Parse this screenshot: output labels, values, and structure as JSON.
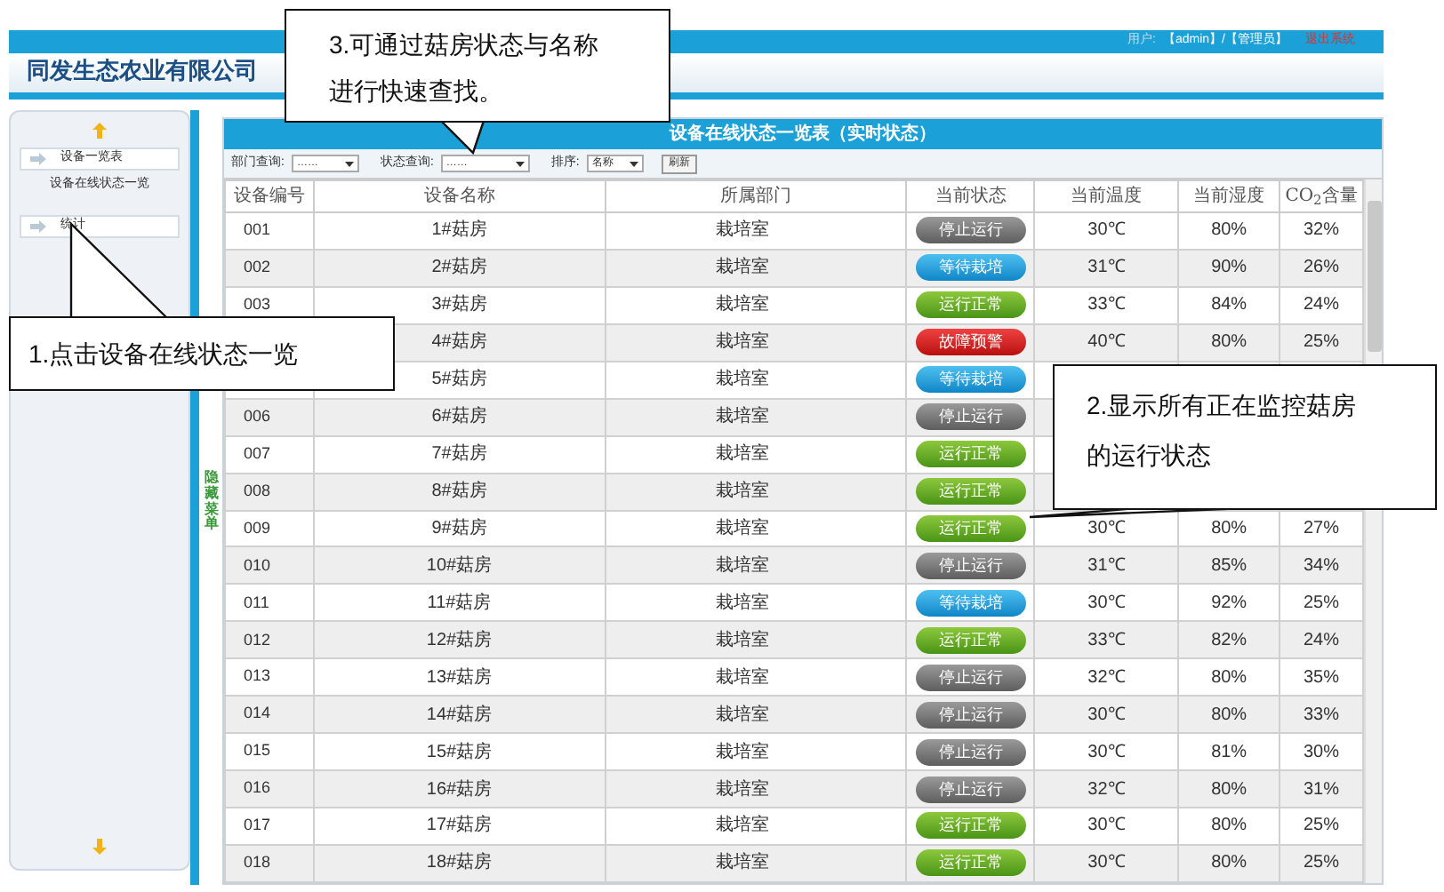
{
  "header": {
    "company": "同发生态农业有限公司",
    "user_label": "用户:",
    "user": "【admin】/【管理员】",
    "logout": "退出系统"
  },
  "sidebar": {
    "items": [
      {
        "label": "设备一览表",
        "kind": "button",
        "selected": false
      },
      {
        "label": "设备在线状态一览",
        "kind": "link",
        "selected": true
      },
      {
        "label": "统计",
        "kind": "button",
        "selected": false
      }
    ],
    "hide_menu": "隐藏菜单"
  },
  "panel": {
    "title": "设备在线状态一览表（实时状态）",
    "filters": [
      {
        "label": "部门查询:",
        "value": "……"
      },
      {
        "label": "状态查询:",
        "value": "……"
      },
      {
        "label": "排序:",
        "value": "名称"
      }
    ],
    "refresh": "刷新"
  },
  "table": {
    "columns": [
      "设备编号",
      "设备名称",
      "所属部门",
      "当前状态",
      "当前温度",
      "当前湿度",
      "CO$_{2}$含量"
    ],
    "rows": [
      {
        "code": "001",
        "name": "1#菇房",
        "dept": "栽培室",
        "status": "停止运行",
        "kind": "stopped",
        "temp": "30℃",
        "humidity": "80%",
        "co2": "32%"
      },
      {
        "code": "002",
        "name": "2#菇房",
        "dept": "栽培室",
        "status": "等待栽培",
        "kind": "waiting",
        "temp": "31℃",
        "humidity": "90%",
        "co2": "26%"
      },
      {
        "code": "003",
        "name": "3#菇房",
        "dept": "栽培室",
        "status": "运行正常",
        "kind": "running",
        "temp": "33℃",
        "humidity": "84%",
        "co2": "24%"
      },
      {
        "name": "4#菇房",
        "dept": "栽培室",
        "status": "故障预警",
        "kind": "fault",
        "temp": "40℃",
        "humidity": "80%",
        "co2": "25%"
      },
      {
        "name": "5#菇房",
        "dept": "栽培室",
        "status": "等待栽培",
        "kind": "waiting"
      },
      {
        "code": "006",
        "name": "6#菇房",
        "dept": "栽培室",
        "status": "停止运行",
        "kind": "stopped"
      },
      {
        "code": "007",
        "name": "7#菇房",
        "dept": "栽培室",
        "status": "运行正常",
        "kind": "running"
      },
      {
        "code": "008",
        "name": "8#菇房",
        "dept": "栽培室",
        "status": "运行正常",
        "kind": "running"
      },
      {
        "code": "009",
        "name": "9#菇房",
        "dept": "栽培室",
        "status": "运行正常",
        "kind": "running",
        "temp": "30℃",
        "humidity": "80%",
        "co2": "27%"
      },
      {
        "code": "010",
        "name": "10#菇房",
        "dept": "栽培室",
        "status": "停止运行",
        "kind": "stopped",
        "temp": "31℃",
        "humidity": "85%",
        "co2": "34%"
      },
      {
        "code": "011",
        "name": "11#菇房",
        "dept": "栽培室",
        "status": "等待栽培",
        "kind": "waiting",
        "temp": "30℃",
        "humidity": "92%",
        "co2": "25%"
      },
      {
        "code": "012",
        "name": "12#菇房",
        "dept": "栽培室",
        "status": "运行正常",
        "kind": "running",
        "temp": "33℃",
        "humidity": "82%",
        "co2": "24%"
      },
      {
        "code": "013",
        "name": "13#菇房",
        "dept": "栽培室",
        "status": "停止运行",
        "kind": "stopped",
        "temp": "32℃",
        "humidity": "80%",
        "co2": "35%"
      },
      {
        "code": "014",
        "name": "14#菇房",
        "dept": "栽培室",
        "status": "停止运行",
        "kind": "stopped",
        "temp": "30℃",
        "humidity": "80%",
        "co2": "33%"
      },
      {
        "code": "015",
        "name": "15#菇房",
        "dept": "栽培室",
        "status": "停止运行",
        "kind": "stopped",
        "temp": "30℃",
        "humidity": "81%",
        "co2": "30%"
      },
      {
        "code": "016",
        "name": "16#菇房",
        "dept": "栽培室",
        "status": "停止运行",
        "kind": "stopped",
        "temp": "32℃",
        "humidity": "80%",
        "co2": "31%"
      },
      {
        "code": "017",
        "name": "17#菇房",
        "dept": "栽培室",
        "status": "运行正常",
        "kind": "running",
        "temp": "30℃",
        "humidity": "80%",
        "co2": "25%"
      },
      {
        "code": "018",
        "name": "18#菇房",
        "dept": "栽培室",
        "status": "运行正常",
        "kind": "running",
        "temp": "30℃",
        "humidity": "80%",
        "co2": "25%"
      }
    ]
  },
  "callouts": [
    "3.可通过菇房状态与名称进行快速查找。",
    "1.点击设备在线状态一览",
    "2.显示所有正在监控菇房的运行状态"
  ]
}
